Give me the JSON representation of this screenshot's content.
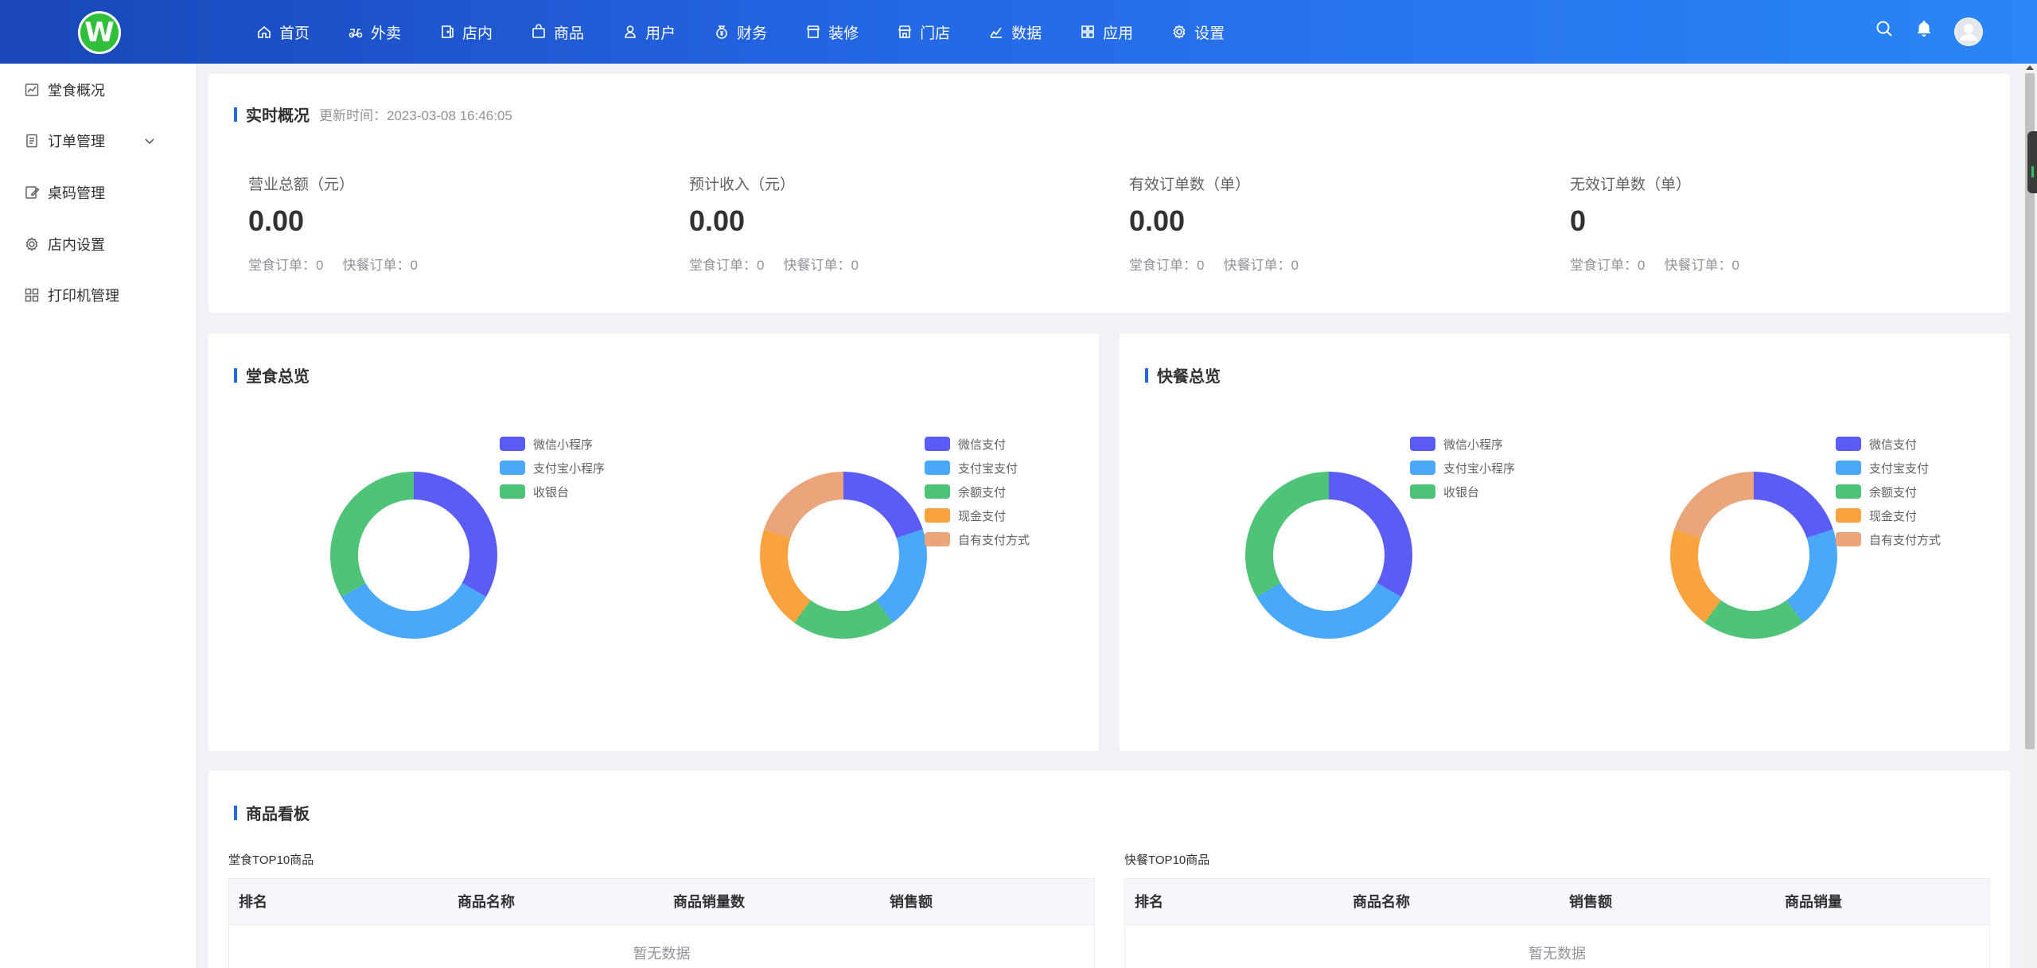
{
  "topnav": {
    "items": [
      {
        "label": "首页",
        "icon": "home-icon"
      },
      {
        "label": "外卖",
        "icon": "scooter-icon"
      },
      {
        "label": "店内",
        "icon": "door-icon"
      },
      {
        "label": "商品",
        "icon": "bag-icon"
      },
      {
        "label": "用户",
        "icon": "user-icon"
      },
      {
        "label": "财务",
        "icon": "money-bag-icon"
      },
      {
        "label": "装修",
        "icon": "storefront-icon"
      },
      {
        "label": "门店",
        "icon": "shop-icon"
      },
      {
        "label": "数据",
        "icon": "line-chart-icon"
      },
      {
        "label": "应用",
        "icon": "grid-icon"
      },
      {
        "label": "设置",
        "icon": "gear-icon"
      }
    ]
  },
  "sidebar": {
    "items": [
      {
        "label": "堂食概况",
        "icon": "chart-icon"
      },
      {
        "label": "订单管理",
        "icon": "document-icon"
      },
      {
        "label": "桌码管理",
        "icon": "edit-icon"
      },
      {
        "label": "店内设置",
        "icon": "gear-icon"
      },
      {
        "label": "打印机管理",
        "icon": "grid-icon"
      }
    ]
  },
  "realtime": {
    "title": "实时概况",
    "update_time": "更新时间：2023-03-08 16:46:05",
    "stats": [
      {
        "label": "营业总额（元）",
        "value": "0.00",
        "dine": "堂食订单：0",
        "fast": "快餐订单：0"
      },
      {
        "label": "预计收入（元）",
        "value": "0.00",
        "dine": "堂食订单：0",
        "fast": "快餐订单：0"
      },
      {
        "label": "有效订单数（单）",
        "value": "0.00",
        "dine": "堂食订单：0",
        "fast": "快餐订单：0"
      },
      {
        "label": "无效订单数（单）",
        "value": "0",
        "dine": "堂食订单：0",
        "fast": "快餐订单：0"
      }
    ]
  },
  "dine_overview": {
    "title": "堂食总览"
  },
  "fast_overview": {
    "title": "快餐总览"
  },
  "colors": {
    "primary": "#2468e6",
    "c1": "#5b5cf6",
    "c2": "#4aa8fb",
    "c3": "#4fc378",
    "c4": "#f8a33e",
    "c5": "#eaa57a"
  },
  "chart_data": [
    {
      "type": "pie",
      "categories": [
        "微信小程序",
        "支付宝小程序",
        "收银台"
      ],
      "values": [
        1,
        1,
        1
      ]
    },
    {
      "type": "pie",
      "categories": [
        "微信支付",
        "支付宝支付",
        "余额支付",
        "现金支付",
        "自有支付方式"
      ],
      "values": [
        1,
        1,
        1,
        1,
        1
      ]
    },
    {
      "type": "pie",
      "categories": [
        "微信小程序",
        "支付宝小程序",
        "收银台"
      ],
      "values": [
        1,
        1,
        1
      ]
    },
    {
      "type": "pie",
      "categories": [
        "微信支付",
        "支付宝支付",
        "余额支付",
        "现金支付",
        "自有支付方式"
      ],
      "values": [
        1,
        1,
        1,
        1,
        1
      ]
    }
  ],
  "goods": {
    "title": "商品看板",
    "dine_caption": "堂食TOP10商品",
    "fast_caption": "快餐TOP10商品",
    "dine_headers": [
      "排名",
      "商品名称",
      "商品销量数",
      "销售额"
    ],
    "fast_headers": [
      "排名",
      "商品名称",
      "销售额",
      "商品销量"
    ],
    "empty_text": "暂无数据"
  }
}
